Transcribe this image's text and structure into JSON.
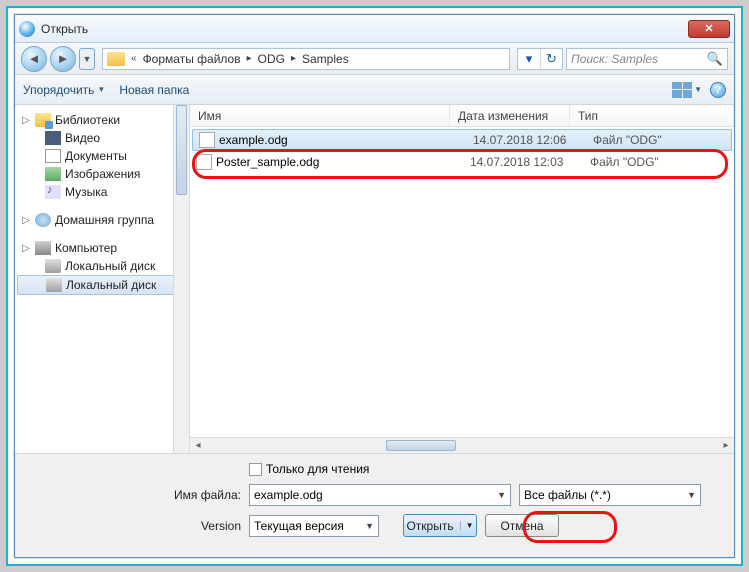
{
  "window": {
    "title": "Открыть"
  },
  "nav": {
    "breadcrumb": [
      "Форматы файлов",
      "ODG",
      "Samples"
    ],
    "search_placeholder": "Поиск: Samples"
  },
  "toolbar": {
    "organize": "Упорядочить",
    "newfolder": "Новая папка"
  },
  "sidebar": {
    "libraries": "Библиотеки",
    "video": "Видео",
    "documents": "Документы",
    "images": "Изображения",
    "music": "Музыка",
    "homegroup": "Домашняя группа",
    "computer": "Компьютер",
    "disk1": "Локальный диск",
    "disk2": "Локальный диск"
  },
  "columns": {
    "name": "Имя",
    "date": "Дата изменения",
    "type": "Тип"
  },
  "files": [
    {
      "name": "example.odg",
      "date": "14.07.2018 12:06",
      "type": "Файл \"ODG\"",
      "selected": true
    },
    {
      "name": "Poster_sample.odg",
      "date": "14.07.2018 12:03",
      "type": "Файл \"ODG\"",
      "selected": false
    }
  ],
  "bottom": {
    "readonly": "Только для чтения",
    "filename_label": "Имя файла:",
    "filename_value": "example.odg",
    "filter_value": "Все файлы (*.*)",
    "version_label": "Version",
    "version_value": "Текущая версия",
    "open": "Открыть",
    "cancel": "Отмена"
  }
}
